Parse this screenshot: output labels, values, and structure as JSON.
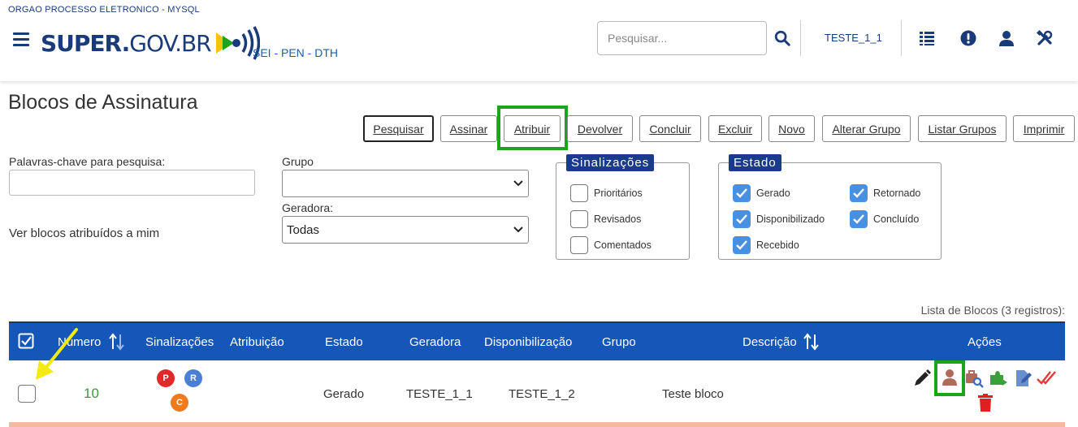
{
  "header": {
    "org": "ORGAO PROCESSO ELETRONICO - MYSQL",
    "logo_bold": "SUPER.",
    "logo_light": "GOV.BR",
    "subtitle": "SEI - PEN - DTH",
    "search_placeholder": "Pesquisar...",
    "user": "TESTE_1_1",
    "icons": [
      "menu-icon",
      "search-icon",
      "list-icon",
      "alert-icon",
      "user-icon",
      "tools-icon"
    ]
  },
  "page": {
    "title": "Blocos de Assinatura"
  },
  "toolbar": {
    "pesquisar": "Pesquisar",
    "assinar": "Assinar",
    "atribuir": "Atribuir",
    "devolver": "Devolver",
    "concluir": "Concluir",
    "excluir": "Excluir",
    "novo": "Novo",
    "alterar_grupo": "Alterar Grupo",
    "listar_grupos": "Listar Grupos",
    "imprimir": "Imprimir"
  },
  "filters": {
    "keywords_label": "Palavras-chave para pesquisa:",
    "keywords_value": "",
    "grupo_label": "Grupo",
    "grupo_value": "",
    "geradora_label": "Geradora:",
    "geradora_value": "Todas",
    "ver_blocos": "Ver blocos atribuídos a mim"
  },
  "sinalizacoes": {
    "legend": "Sinalizações",
    "items": [
      {
        "label": "Prioritários",
        "checked": false
      },
      {
        "label": "Revisados",
        "checked": false
      },
      {
        "label": "Comentados",
        "checked": false
      }
    ]
  },
  "estado": {
    "legend": "Estado",
    "items": [
      {
        "label": "Gerado",
        "checked": true
      },
      {
        "label": "Retornado",
        "checked": true
      },
      {
        "label": "Disponibilizado",
        "checked": true
      },
      {
        "label": "Concluído",
        "checked": true
      },
      {
        "label": "Recebido",
        "checked": true
      }
    ]
  },
  "table": {
    "count_label": "Lista de Blocos (3 registros):",
    "columns": {
      "numero": "Número",
      "sinalizacoes": "Sinalizações",
      "atribuicao": "Atribuição",
      "estado": "Estado",
      "geradora": "Geradora",
      "disponibilizacao": "Disponibilização",
      "grupo": "Grupo",
      "descricao": "Descrição",
      "acoes": "Ações"
    },
    "rows": [
      {
        "numero": "10",
        "badges": [
          "P",
          "R",
          "C"
        ],
        "atribuicao": "",
        "estado": "Gerado",
        "geradora": "TESTE_1_1",
        "disponibilizacao": "TESTE_1_2",
        "grupo": "",
        "descricao": "Teste bloco"
      }
    ]
  },
  "colors": {
    "brand": "#1a3b7a",
    "header_row": "#1557b8",
    "highlight": "#1ca51c",
    "checkbox": "#4a90e2",
    "numero": "#3c9a3c",
    "badge_p": "#e02a2a",
    "badge_r": "#4a7fd6",
    "badge_c": "#f07a1e"
  }
}
